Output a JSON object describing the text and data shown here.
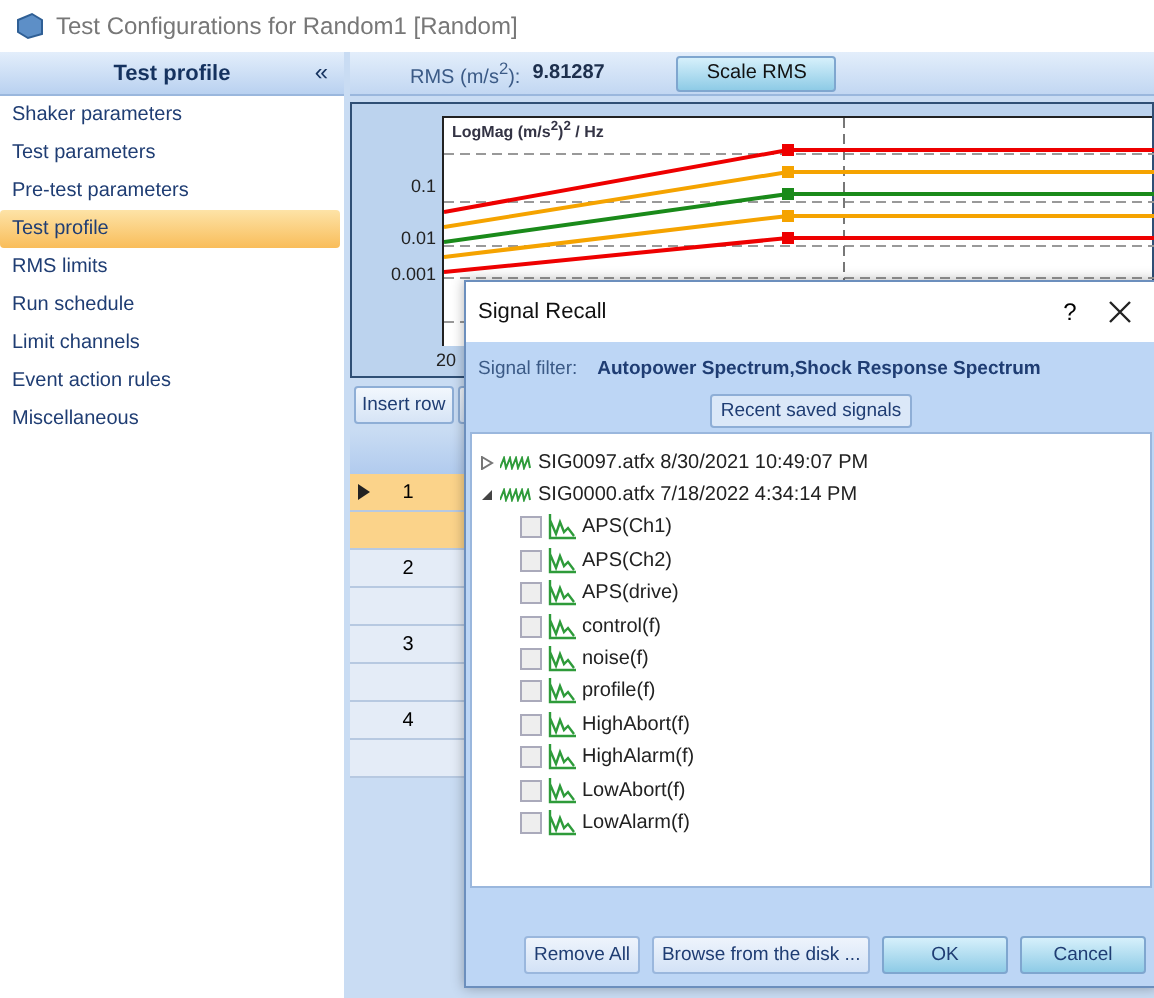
{
  "window": {
    "title": "Test Configurations for Random1 [Random]"
  },
  "sidebar": {
    "title": "Test profile",
    "collapse": "«",
    "items": [
      {
        "label": "Shaker parameters",
        "selected": false
      },
      {
        "label": "Test parameters",
        "selected": false
      },
      {
        "label": "Pre-test parameters",
        "selected": false
      },
      {
        "label": "Test profile",
        "selected": true
      },
      {
        "label": "RMS limits",
        "selected": false
      },
      {
        "label": "Run schedule",
        "selected": false
      },
      {
        "label": "Limit channels",
        "selected": false
      },
      {
        "label": "Event action rules",
        "selected": false
      },
      {
        "label": "Miscellaneous",
        "selected": false
      }
    ]
  },
  "rms_bar": {
    "label": "RMS (m/s$^{2}$):",
    "value": "9.81287",
    "button": "Scale RMS"
  },
  "chart": {
    "axis_title": "LogMag (m/s$^{2}$)$^{2}$ / Hz",
    "yticks": [
      "0.1",
      "0.01",
      "0.001"
    ],
    "xtick": "20"
  },
  "toolbar": {
    "buttons": [
      "Insert row"
    ]
  },
  "grid": {
    "rows": [
      {
        "label": "1",
        "selected": true
      },
      {
        "label": "2",
        "selected": false
      },
      {
        "label": "3",
        "selected": false
      },
      {
        "label": "4",
        "selected": false
      }
    ]
  },
  "dialog": {
    "title": "Signal Recall",
    "help": "?",
    "filter_label": "Signal filter:",
    "filter_value": "Autopower Spectrum,Shock Response Spectrum",
    "group_label": "Recent saved signals",
    "tree": [
      {
        "label": "SIG0097.atfx 8/30/2021 10:49:07 PM",
        "expanded": false
      },
      {
        "label": "SIG0000.atfx 7/18/2022 4:34:14 PM",
        "expanded": true,
        "children": [
          {
            "label": "APS(Ch1)",
            "checked": false
          },
          {
            "label": "APS(Ch2)",
            "checked": false
          },
          {
            "label": "APS(drive)",
            "checked": false
          },
          {
            "label": "control(f)",
            "checked": false
          },
          {
            "label": "noise(f)",
            "checked": false
          },
          {
            "label": "profile(f)",
            "checked": false
          },
          {
            "label": "HighAbort(f)",
            "checked": false
          },
          {
            "label": "HighAlarm(f)",
            "checked": false
          },
          {
            "label": "LowAbort(f)",
            "checked": false
          },
          {
            "label": "LowAlarm(f)",
            "checked": false
          }
        ]
      }
    ],
    "buttons": [
      {
        "label": "Remove All",
        "kind": "plain"
      },
      {
        "label": "Browse from the disk ...",
        "kind": "plain"
      },
      {
        "label": "OK",
        "kind": "primary"
      },
      {
        "label": "Cancel",
        "kind": "primary"
      }
    ]
  }
}
